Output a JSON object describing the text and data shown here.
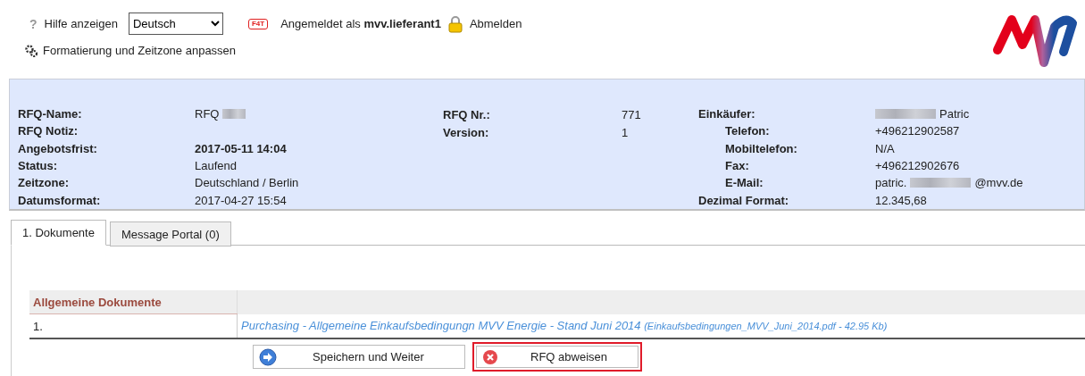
{
  "header": {
    "help": {
      "icon": "?",
      "label": "Hilfe anzeigen"
    },
    "language": {
      "value": "Deutsch"
    },
    "badge": "F4T",
    "login": "Angemeldet als **mvv.lieferant1**",
    "logout": "Abmelden",
    "settings": "Formatierung und Zeitzone anpassen"
  },
  "info": {
    "left": [
      {
        "label": "RFQ-Name:",
        "value": [
          {
            "kind": "text",
            "text": "RFQ"
          },
          {
            "kind": "blur"
          }
        ]
      },
      {
        "label": "RFQ Notiz:"
      },
      {
        "label": "Angebotsfrist:",
        "value": [
          {
            "kind": "bold",
            "text": "2017-05-11 14:04"
          }
        ]
      },
      {
        "label": "Status:",
        "value": [
          {
            "kind": "text",
            "text": "Laufend"
          }
        ]
      },
      {
        "label": "Zeitzone:",
        "value": [
          {
            "kind": "text",
            "text": "Deutschland / Berlin"
          }
        ]
      },
      {
        "label": "Datumsformat:",
        "value": [
          {
            "kind": "text",
            "text": "2017-04-27 15:54"
          }
        ]
      }
    ],
    "middle": [
      {
        "label": "RFQ Nr.:",
        "value": [
          {
            "kind": "text",
            "text": "771"
          }
        ]
      },
      {
        "label": "Version:",
        "value": [
          {
            "kind": "text",
            "text": "1"
          }
        ]
      }
    ],
    "right": [
      {
        "label": "Einkäufer:",
        "value": [
          {
            "kind": "blur"
          },
          {
            "kind": "text",
            "text": "Patric"
          }
        ],
        "children": [
          {
            "label": "Telefon:",
            "value": [
              {
                "kind": "text",
                "text": "+496212902587"
              }
            ]
          },
          {
            "label": "Mobiltelefon:",
            "value": [
              {
                "kind": "text",
                "text": "N/A"
              }
            ]
          },
          {
            "label": "Fax:",
            "value": [
              {
                "kind": "text",
                "text": "+496212902676"
              }
            ]
          },
          {
            "label": "E-Mail:",
            "value": [
              {
                "kind": "text",
                "text": "patric."
              },
              {
                "kind": "blur"
              },
              {
                "kind": "text",
                "text": "@mvv.de"
              }
            ]
          }
        ]
      },
      {
        "label": "Dezimal Format:",
        "value": [
          {
            "kind": "text",
            "text": "12.345,68"
          }
        ]
      }
    ]
  },
  "tabs": [
    {
      "label": "1. Dokumente",
      "selected": true
    },
    {
      "label": "Message Portal (0)",
      "selected": false
    }
  ],
  "documents": {
    "heading": "Allgemeine Dokumente",
    "rows": [
      {
        "number": "1.",
        "title": "Purchasing - Allgemeine Einkaufsbedingungn MVV Energie - Stand Juni 2014",
        "file": "(Einkaufsbedingungen_MVV_Juni_2014.pdf - 42.95 Kb)"
      }
    ]
  },
  "buttons": [
    {
      "kind": "next",
      "label": "Speichern und Weiter",
      "highlighted": false
    },
    {
      "kind": "reject",
      "label": "RFQ abweisen",
      "highlighted": true
    }
  ]
}
